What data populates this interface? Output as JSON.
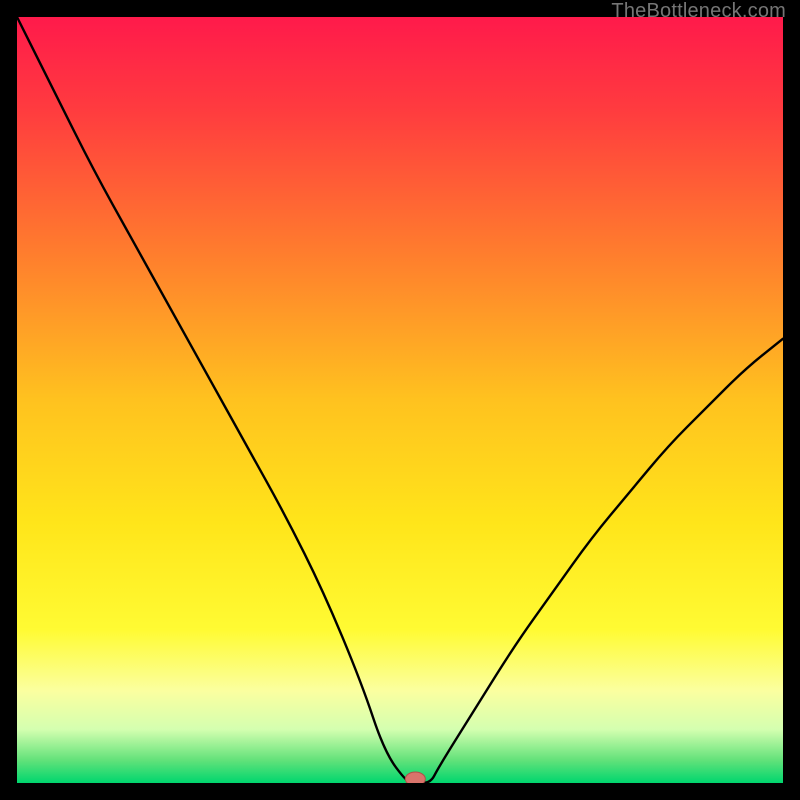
{
  "watermark": "TheBottleneck.com",
  "colors": {
    "frame": "#000000",
    "gradient_stops": [
      {
        "offset": 0.0,
        "color": "#ff1a4b"
      },
      {
        "offset": 0.12,
        "color": "#ff3b3f"
      },
      {
        "offset": 0.3,
        "color": "#ff7a2e"
      },
      {
        "offset": 0.5,
        "color": "#ffc21f"
      },
      {
        "offset": 0.66,
        "color": "#ffe51a"
      },
      {
        "offset": 0.8,
        "color": "#fffb33"
      },
      {
        "offset": 0.88,
        "color": "#fbffa0"
      },
      {
        "offset": 0.93,
        "color": "#d4ffb0"
      },
      {
        "offset": 0.97,
        "color": "#63e27a"
      },
      {
        "offset": 1.0,
        "color": "#00d66e"
      }
    ],
    "curve": "#000000",
    "marker_fill": "#d9746b",
    "marker_stroke": "#b05048"
  },
  "chart_data": {
    "type": "line",
    "title": "",
    "xlabel": "",
    "ylabel": "",
    "xlim": [
      0,
      100
    ],
    "ylim": [
      0,
      100
    ],
    "x": [
      0,
      5,
      10,
      15,
      20,
      25,
      30,
      35,
      40,
      45,
      48,
      51,
      52,
      54,
      55,
      60,
      65,
      70,
      75,
      80,
      85,
      90,
      95,
      100
    ],
    "values": [
      100,
      90,
      80,
      71,
      62,
      53,
      44,
      35,
      25,
      13,
      4,
      0,
      0,
      0,
      2,
      10,
      18,
      25,
      32,
      38,
      44,
      49,
      54,
      58
    ],
    "marker": {
      "x": 52,
      "y": 0
    }
  }
}
